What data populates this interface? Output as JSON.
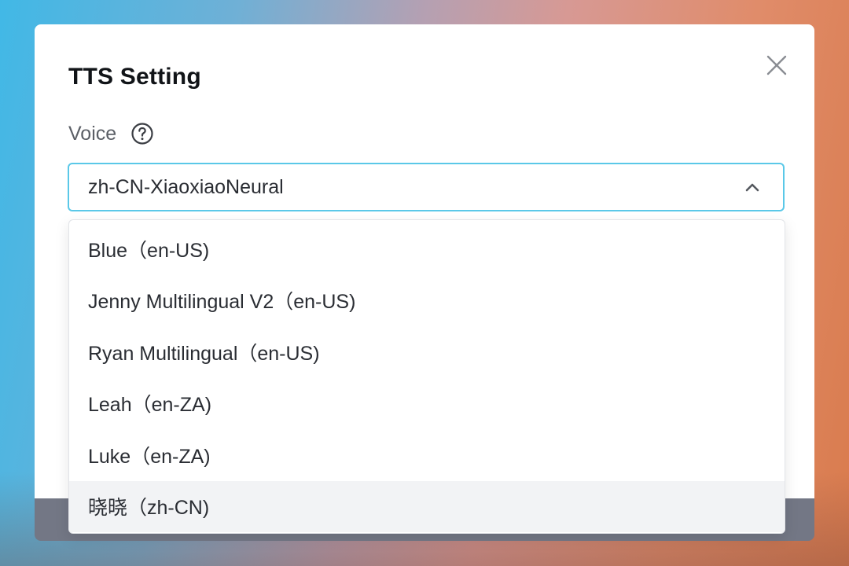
{
  "dialog": {
    "title": "TTS Setting",
    "close_icon": "close-icon"
  },
  "voice_field": {
    "label": "Voice",
    "help_icon": "help-circle-icon",
    "selected_value": "zh-CN-XiaoxiaoNeural",
    "arrow_icon": "chevron-up-icon",
    "accent_color": "#5ac8e8"
  },
  "dropdown": {
    "options": [
      {
        "label": "Blue（en-US)"
      },
      {
        "label": "Jenny Multilingual V2（en-US)"
      },
      {
        "label": "Ryan Multilingual（en-US)"
      },
      {
        "label": "Leah（en-ZA)"
      },
      {
        "label": "Luke（en-ZA)"
      },
      {
        "label": "晓晓（zh-CN)"
      }
    ],
    "highlighted_index": 5,
    "highlight_color": "#f2f3f5"
  }
}
